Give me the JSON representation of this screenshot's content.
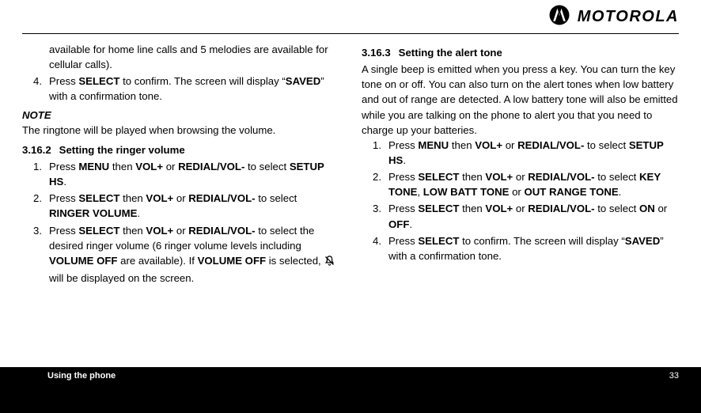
{
  "brand": {
    "name": "MOTOROLA"
  },
  "icons": {
    "bell_off": "bell-off-icon"
  },
  "left": {
    "trailing1": "available for home line calls and 5 melodies are available for cellular calls).",
    "step4": {
      "num": "4.",
      "t1": "Press ",
      "b1": "SELECT",
      "t2": " to confirm. The screen will display “",
      "b2": "SAVED",
      "t3": "” with a confirmation tone."
    },
    "note_label": "NOTE",
    "note_body": "The ringtone will be played when browsing the volume.",
    "sub_num": "3.16.2",
    "sub_title": "Setting the ringer volume",
    "s1": {
      "num": "1.",
      "t1": "Press ",
      "b1": "MENU",
      "t2": " then ",
      "b2": "VOL+",
      "t3": " or ",
      "b3": "REDIAL/VOL-",
      "t4": " to select ",
      "b4": "SETUP HS",
      "t5": "."
    },
    "s2": {
      "num": "2.",
      "t1": "Press ",
      "b1": "SELECT",
      "t2": " then ",
      "b2": "VOL+",
      "t3": " or ",
      "b3": "REDIAL/VOL-",
      "t4": " to select ",
      "b4": "RINGER VOLUME",
      "t5": "."
    },
    "s3": {
      "num": "3.",
      "t1": "Press ",
      "b1": "SELECT",
      "t2": " then ",
      "b2": "VOL+",
      "t3": " or ",
      "b3": "REDIAL/VOL-",
      "t4": " to select the desired ringer volume (6 ringer volume levels including ",
      "b4": "VOLUME OFF",
      "t5": " are available). If ",
      "b5": "VOLUME OFF",
      "t6": " is selected, ",
      "t7": " will be displayed on the screen."
    }
  },
  "right": {
    "sub_num": "3.16.3",
    "sub_title": "Setting the alert tone",
    "intro": "A single beep is emitted when you press a key. You can turn the key tone on or off. You can also turn on the alert tones when low battery and out of range are detected. A low battery tone will also be emitted while you are talking on the phone to alert you that you need to charge up your batteries.",
    "s1": {
      "num": "1.",
      "t1": "Press ",
      "b1": "MENU",
      "t2": " then ",
      "b2": "VOL+",
      "t3": " or ",
      "b3": "REDIAL/VOL-",
      "t4": " to select ",
      "b4": "SETUP HS",
      "t5": "."
    },
    "s2": {
      "num": "2.",
      "t1": "Press ",
      "b1": "SELECT",
      "t2": " then ",
      "b2": "VOL+",
      "t3": " or ",
      "b3": "REDIAL/VOL-",
      "t4": " to select ",
      "b4": "KEY TONE",
      "t5": ", ",
      "b5": "LOW BATT TONE",
      "t6": " or ",
      "b6": "OUT RANGE TONE",
      "t7": "."
    },
    "s3": {
      "num": "3.",
      "t1": "Press ",
      "b1": "SELECT",
      "t2": " then ",
      "b2": "VOL+",
      "t3": " or ",
      "b3": "REDIAL/VOL-",
      "t4": " to select ",
      "b4": "ON",
      "t5": " or ",
      "b5": "OFF",
      "t6": "."
    },
    "s4": {
      "num": "4.",
      "t1": "Press ",
      "b1": "SELECT",
      "t2": " to confirm. The screen will display “",
      "b2": "SAVED",
      "t3": "” with a confirmation tone."
    }
  },
  "footer": {
    "section": "Using the phone",
    "page": "33"
  }
}
